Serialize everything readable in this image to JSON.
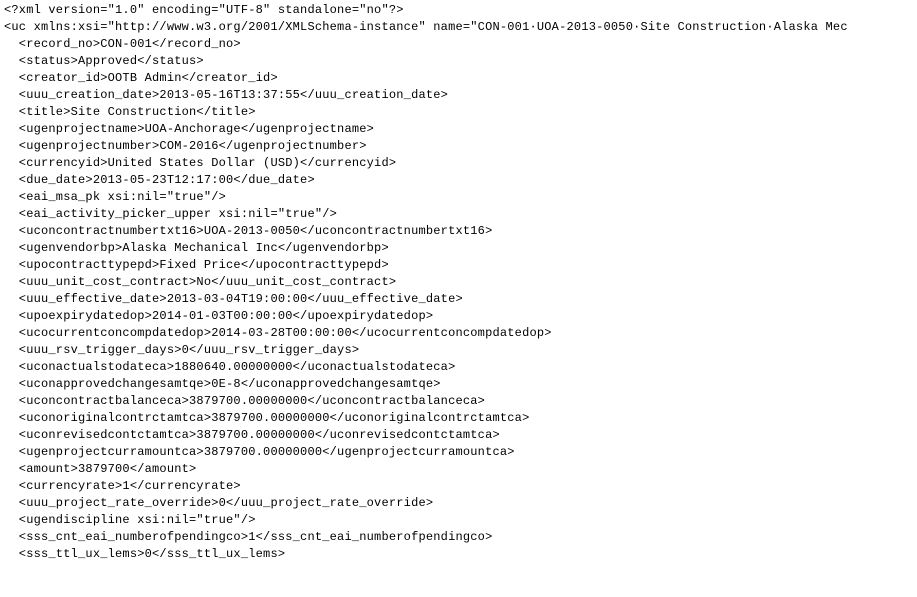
{
  "xml_lines": [
    "<?xml version=\"1.0\" encoding=\"UTF-8\" standalone=\"no\"?>",
    "<uc xmlns:xsi=\"http://www.w3.org/2001/XMLSchema-instance\" name=\"CON-001·UOA-2013-0050·Site Construction·Alaska Mec",
    "  <record_no>CON-001</record_no>",
    "  <status>Approved</status>",
    "  <creator_id>OOTB Admin</creator_id>",
    "  <uuu_creation_date>2013-05-16T13:37:55</uuu_creation_date>",
    "  <title>Site Construction</title>",
    "  <ugenprojectname>UOA-Anchorage</ugenprojectname>",
    "  <ugenprojectnumber>COM-2016</ugenprojectnumber>",
    "  <currencyid>United States Dollar (USD)</currencyid>",
    "  <due_date>2013-05-23T12:17:00</due_date>",
    "  <eai_msa_pk xsi:nil=\"true\"/>",
    "  <eai_activity_picker_upper xsi:nil=\"true\"/>",
    "  <uconcontractnumbertxt16>UOA-2013-0050</uconcontractnumbertxt16>",
    "  <ugenvendorbp>Alaska Mechanical Inc</ugenvendorbp>",
    "  <upocontracttypepd>Fixed Price</upocontracttypepd>",
    "  <uuu_unit_cost_contract>No</uuu_unit_cost_contract>",
    "  <uuu_effective_date>2013-03-04T19:00:00</uuu_effective_date>",
    "  <upoexpirydatedop>2014-01-03T00:00:00</upoexpirydatedop>",
    "  <ucocurrentconcompdatedop>2014-03-28T00:00:00</ucocurrentconcompdatedop>",
    "  <uuu_rsv_trigger_days>0</uuu_rsv_trigger_days>",
    "  <uconactualstodateca>1880640.00000000</uconactualstodateca>",
    "  <uconapprovedchangesamtqe>0E-8</uconapprovedchangesamtqe>",
    "  <uconcontractbalanceca>3879700.00000000</uconcontractbalanceca>",
    "  <uconoriginalcontrctamtca>3879700.00000000</uconoriginalcontrctamtca>",
    "  <uconrevisedcontctamtca>3879700.00000000</uconrevisedcontctamtca>",
    "  <ugenprojectcurramountca>3879700.00000000</ugenprojectcurramountca>",
    "  <amount>3879700</amount>",
    "  <currencyrate>1</currencyrate>",
    "  <uuu_project_rate_override>0</uuu_project_rate_override>",
    "  <ugendiscipline xsi:nil=\"true\"/>",
    "  <sss_cnt_eai_numberofpendingco>1</sss_cnt_eai_numberofpendingco>",
    "  <sss_ttl_ux_lems>0</sss_ttl_ux_lems>"
  ]
}
